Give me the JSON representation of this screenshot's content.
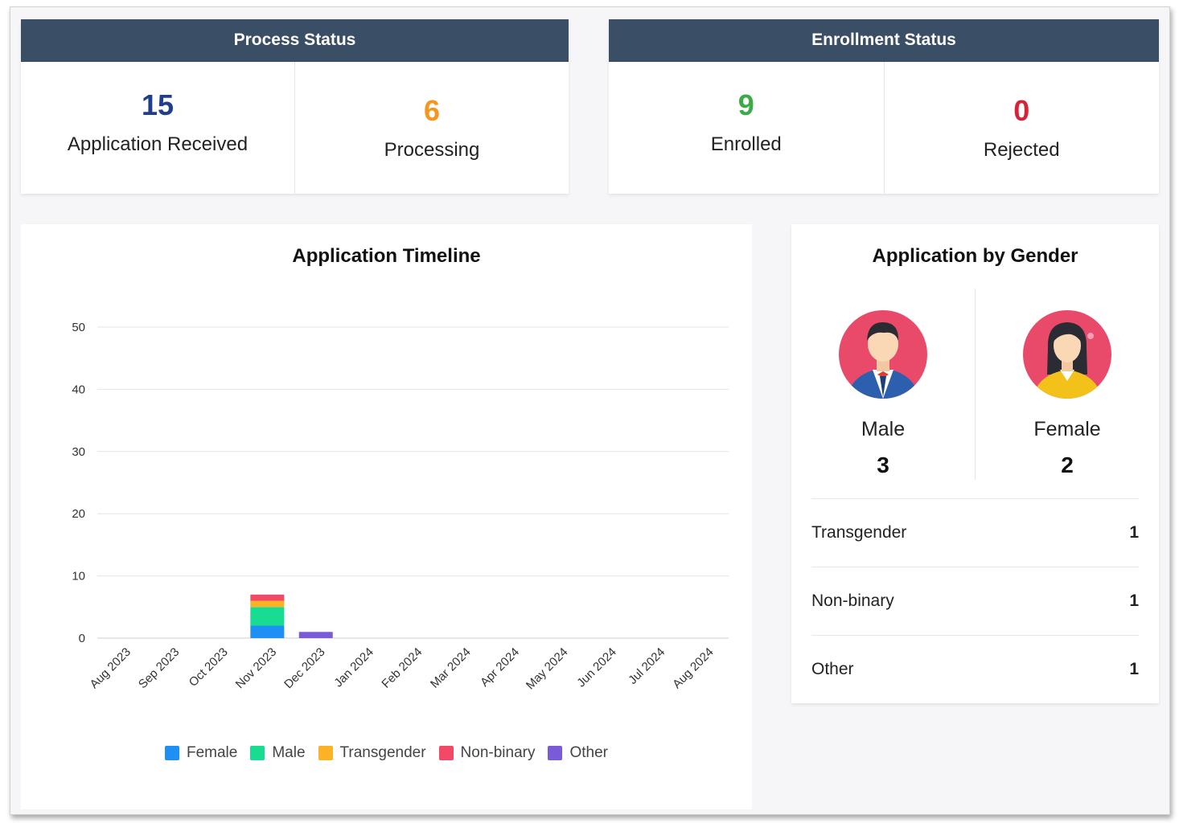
{
  "process_status": {
    "title": "Process Status",
    "received": {
      "value": "15",
      "label": "Application Received",
      "color": "#1f3f8c"
    },
    "processing": {
      "value": "6",
      "label": "Processing",
      "color": "#f5961e"
    }
  },
  "enrollment_status": {
    "title": "Enrollment Status",
    "enrolled": {
      "value": "9",
      "label": "Enrolled",
      "color": "#3daa4a"
    },
    "rejected": {
      "value": "0",
      "label": "Rejected",
      "color": "#d7233a"
    }
  },
  "timeline": {
    "title": "Application Timeline",
    "legend": [
      {
        "label": "Female",
        "color": "#1e8ff5"
      },
      {
        "label": "Male",
        "color": "#17dc92"
      },
      {
        "label": "Transgender",
        "color": "#fbb224"
      },
      {
        "label": "Non-binary",
        "color": "#f24966"
      },
      {
        "label": "Other",
        "color": "#7a5bd7"
      }
    ]
  },
  "chart_data": {
    "type": "bar",
    "stacked": true,
    "categories": [
      "Aug 2023",
      "Sep 2023",
      "Oct 2023",
      "Nov 2023",
      "Dec 2023",
      "Jan 2024",
      "Feb 2024",
      "Mar 2024",
      "Apr 2024",
      "May 2024",
      "Jun 2024",
      "Jul 2024",
      "Aug 2024"
    ],
    "series": [
      {
        "name": "Female",
        "color": "#1e8ff5",
        "values": [
          0,
          0,
          0,
          2,
          0,
          0,
          0,
          0,
          0,
          0,
          0,
          0,
          0
        ]
      },
      {
        "name": "Male",
        "color": "#17dc92",
        "values": [
          0,
          0,
          0,
          3,
          0,
          0,
          0,
          0,
          0,
          0,
          0,
          0,
          0
        ]
      },
      {
        "name": "Transgender",
        "color": "#fbb224",
        "values": [
          0,
          0,
          0,
          1,
          0,
          0,
          0,
          0,
          0,
          0,
          0,
          0,
          0
        ]
      },
      {
        "name": "Non-binary",
        "color": "#f24966",
        "values": [
          0,
          0,
          0,
          1,
          0,
          0,
          0,
          0,
          0,
          0,
          0,
          0,
          0
        ]
      },
      {
        "name": "Other",
        "color": "#7a5bd7",
        "values": [
          0,
          0,
          0,
          0,
          1,
          0,
          0,
          0,
          0,
          0,
          0,
          0,
          0
        ]
      }
    ],
    "yticks": [
      0,
      10,
      20,
      30,
      40,
      50
    ],
    "ylim": [
      0,
      50
    ],
    "grid": true,
    "legend_position": "bottom"
  },
  "gender": {
    "title": "Application by Gender",
    "male": {
      "label": "Male",
      "count": "3",
      "icon": "male-avatar-icon"
    },
    "female": {
      "label": "Female",
      "count": "2",
      "icon": "female-avatar-icon"
    },
    "others": [
      {
        "label": "Transgender",
        "count": "1"
      },
      {
        "label": "Non-binary",
        "count": "1"
      },
      {
        "label": "Other",
        "count": "1"
      }
    ]
  }
}
